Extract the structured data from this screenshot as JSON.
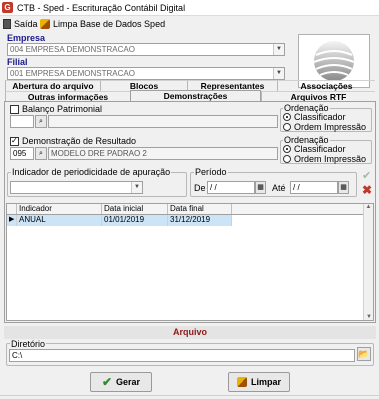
{
  "window": {
    "title": "CTB - Sped - Escrituração Contábil Digital"
  },
  "menu": {
    "saida": "Saída",
    "limpa": "Limpa Base de Dados Sped"
  },
  "empresa": {
    "label": "Empresa",
    "value": "004 EMPRESA DEMONSTRACAO"
  },
  "filial": {
    "label": "Filial",
    "value": "001 EMPRESA DEMONSTRACAO"
  },
  "tabs_row1": [
    "Abertura do arquivo",
    "Blocos",
    "Representantes legais",
    "Associações"
  ],
  "tabs_row2": [
    "Outras informações",
    "Demonstrações",
    "Arquivos RTF"
  ],
  "balanco": {
    "label": "Balanço Patrimonial",
    "checked": false,
    "code": "",
    "name": "",
    "ordenacao_label": "Ordenação",
    "opt1": "Classificador",
    "opt2": "Ordem Impressão"
  },
  "demonstracao": {
    "label": "Demonstração de Resultado",
    "checked": true,
    "code": "095",
    "name": "MODELO DRE PADRAO 2",
    "ordenacao_label": "Ordenação",
    "opt1": "Classificador",
    "opt2": "Ordem Impressão"
  },
  "indicador": {
    "label": "Indicador de periodicidade de apuração",
    "value": ""
  },
  "periodo": {
    "label": "Período",
    "de_label": "De",
    "de_value": "/ /",
    "ate_label": "Até",
    "ate_value": "/ /"
  },
  "grid": {
    "headers": [
      "Indicador",
      "Data inicial",
      "Data final"
    ],
    "rows": [
      [
        "ANUAL",
        "01/01/2019",
        "31/12/2019"
      ]
    ]
  },
  "arquivo": {
    "section": "Arquivo",
    "diretorio_label": "Diretório",
    "diretorio_value": "C:\\"
  },
  "buttons": {
    "gerar": "Gerar",
    "limpar": "Limpar"
  },
  "colors": {
    "accent_red": "#c0392b",
    "section_text": "#8b1a1a",
    "label_blue": "#1a1a8c",
    "selection": "#cce4f7"
  },
  "icons": {
    "app": "app-logo-icon",
    "exit": "door-exit-icon",
    "clean": "brush-icon",
    "folder": "folder-icon",
    "calendar": "calendar-icon",
    "check": "green-check-icon",
    "delete": "red-x-icon"
  }
}
